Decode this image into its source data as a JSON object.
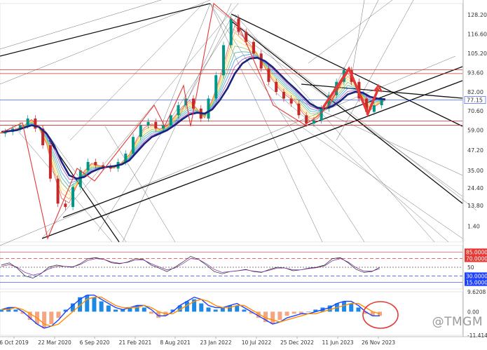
{
  "chart_data": [
    {
      "type": "line",
      "panel": "price",
      "x": [
        "6 Oct 2019",
        "22 Mar 2020",
        "6 Sep 2020",
        "21 Feb 2021",
        "8 Aug 2021",
        "23 Jan 2022",
        "10 Jul 2022",
        "25 Dec 2022",
        "11 Jun 2023",
        "26 Nov 2023"
      ],
      "ylim": [
        -8,
        135
      ],
      "y_tick_labels": [
        "128.20",
        "116.60",
        "105.20",
        "93.60",
        "82.00",
        "70.60",
        "59.00",
        "47.20",
        "35.00",
        "24.40",
        "13.80",
        "1.40"
      ],
      "y_tick_values": [
        128.2,
        116.6,
        105.2,
        93.6,
        82.0,
        70.6,
        59.0,
        47.2,
        35.0,
        24.4,
        13.8,
        1.4
      ],
      "last_price_label": "77.15",
      "last_price": 77.15,
      "horizontal_levels": [
        95.2,
        93.0,
        64.5,
        62.0
      ],
      "series": [
        {
          "values": [
            57,
            58,
            60,
            62,
            66,
            60,
            50,
            30,
            15,
            13,
            25,
            35,
            40,
            38,
            37,
            36,
            40,
            45,
            55,
            62,
            64,
            60,
            62,
            68,
            74,
            78,
            72,
            66,
            78,
            92,
            110,
            126,
            118,
            112,
            105,
            96,
            88,
            82,
            78,
            75,
            68,
            63,
            65,
            72,
            80,
            88,
            95,
            88,
            78,
            70,
            74,
            77
          ]
        },
        {
          "values": [
            58,
            58.5,
            59,
            60.5,
            62,
            61,
            57,
            50,
            40,
            32,
            30,
            31,
            34,
            36,
            37,
            37.5,
            38.5,
            41,
            46,
            51,
            55,
            57,
            59,
            62,
            65.5,
            68.5,
            69.5,
            69,
            71.5,
            77,
            84,
            93,
            99,
            102,
            102.5,
            100.5,
            97,
            92.5,
            88,
            84,
            79.5,
            75,
            72.5,
            72,
            73.5,
            76.5,
            80.5,
            82,
            81.5,
            79,
            78,
            77.5
          ]
        }
      ]
    },
    {
      "type": "line",
      "panel": "rsi",
      "levels": [
        85,
        70,
        50,
        30,
        15
      ],
      "level_labels": [
        "85.0000",
        "70.0000",
        "30.0000",
        "15.0000"
      ],
      "level_50_label": "50",
      "series": [
        {
          "values": [
            55,
            60,
            48,
            30,
            25,
            35,
            50,
            55,
            52,
            50,
            58,
            70,
            72,
            68,
            60,
            58,
            62,
            70,
            68,
            55,
            48,
            40,
            50,
            62,
            75,
            68,
            55,
            40,
            35,
            40,
            42,
            45,
            40,
            38,
            45,
            50,
            48,
            42,
            44,
            48,
            50,
            55,
            70,
            72,
            60,
            45,
            38,
            40,
            50
          ]
        },
        {
          "values": [
            52,
            56,
            50,
            38,
            32,
            36,
            46,
            52,
            52,
            51,
            56,
            66,
            70,
            68,
            62,
            59,
            61,
            67,
            67,
            58,
            51,
            44,
            48,
            58,
            70,
            68,
            58,
            45,
            38,
            40,
            42,
            44,
            41,
            39,
            43,
            48,
            48,
            44,
            44,
            47,
            49,
            53,
            65,
            70,
            62,
            49,
            41,
            41,
            47
          ]
        }
      ]
    },
    {
      "type": "bar",
      "panel": "macd",
      "y_tick_labels": [
        "9.6208",
        "0.00",
        "-11.4147"
      ],
      "y_tick_values": [
        9.6208,
        0,
        -11.4147
      ],
      "histogram": [
        1,
        2,
        1,
        -1,
        -4,
        -6,
        -8,
        -6,
        -3,
        1,
        4,
        7,
        8,
        7,
        5,
        3,
        1,
        1,
        2,
        3,
        2,
        -1,
        -3,
        -2,
        1,
        3,
        5,
        6,
        4,
        2,
        1,
        2,
        3,
        3,
        1,
        -1,
        -3,
        -5,
        -6,
        -4,
        -2,
        -1,
        -1,
        0,
        1,
        2,
        3,
        4,
        5,
        4,
        2,
        -1,
        -2,
        -2
      ],
      "series": [
        {
          "values": [
            1,
            2,
            2,
            0,
            -3,
            -6,
            -8,
            -7,
            -4,
            0,
            3,
            6,
            8,
            8,
            6,
            4,
            2,
            1,
            2,
            3,
            3,
            1,
            -2,
            -2,
            0,
            3,
            5,
            7,
            6,
            3,
            2,
            2,
            3,
            4,
            2,
            0,
            -2,
            -4,
            -6,
            -5,
            -3,
            -2,
            -1,
            -1,
            0,
            1,
            2,
            4,
            5,
            5,
            3,
            0,
            -2,
            -2
          ]
        },
        {
          "values": [
            1,
            1,
            2,
            1,
            -1,
            -3,
            -6,
            -7,
            -6,
            -3,
            0,
            3,
            6,
            7,
            7,
            5,
            3,
            2,
            2,
            2,
            3,
            2,
            0,
            -1,
            -1,
            1,
            3,
            5,
            6,
            5,
            3,
            2,
            2,
            3,
            3,
            1,
            -1,
            -3,
            -4,
            -5,
            -4,
            -3,
            -2,
            -1,
            -1,
            0,
            1,
            2,
            3,
            4,
            4,
            2,
            0,
            -1
          ]
        }
      ]
    }
  ],
  "colors": {
    "price_up": "#009688",
    "price_down": "#c62828",
    "ma_heavy": "#1a237e",
    "last_price_line": "#1e40ff",
    "level_red": "#d32f2f",
    "zigzag": "#e53935",
    "rsi_85": "#e53935",
    "rsi_70": "#e53935",
    "rsi_30": "#1e40ff",
    "rsi_15": "#1e40ff",
    "macd_hist_pos": "#1e88e5",
    "macd_hist_neg": "#f4a582",
    "macd_line": "#1e40ff",
    "macd_signal": "#ff8f00",
    "highlight_circle": "#e53935"
  },
  "watermark": "@TMGM"
}
